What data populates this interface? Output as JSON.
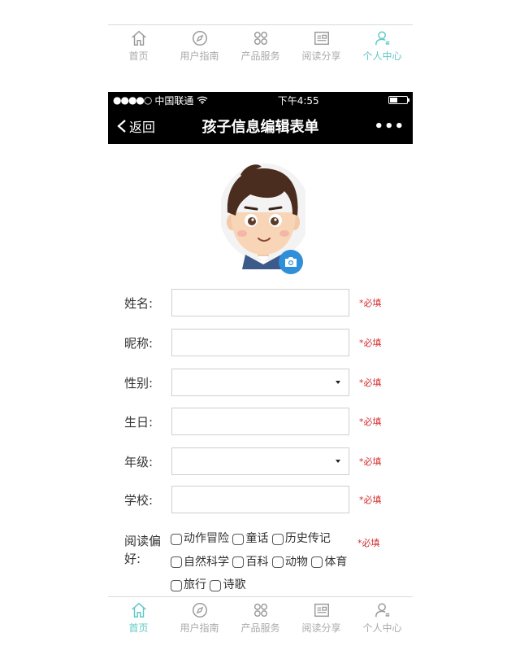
{
  "top_tabs": [
    {
      "label": "首页",
      "icon": "home-icon",
      "active": false
    },
    {
      "label": "用户指南",
      "icon": "compass-icon",
      "active": false
    },
    {
      "label": "产品服务",
      "icon": "grid-icon",
      "active": false
    },
    {
      "label": "阅读分享",
      "icon": "news-icon",
      "active": false
    },
    {
      "label": "个人中心",
      "icon": "user-icon",
      "active": true
    }
  ],
  "bottom_tabs": [
    {
      "label": "首页",
      "icon": "home-icon",
      "active": true
    },
    {
      "label": "用户指南",
      "icon": "compass-icon",
      "active": false
    },
    {
      "label": "产品服务",
      "icon": "grid-icon",
      "active": false
    },
    {
      "label": "阅读分享",
      "icon": "news-icon",
      "active": false
    },
    {
      "label": "个人中心",
      "icon": "user-icon",
      "active": false
    }
  ],
  "status_bar": {
    "carrier": "中国联通",
    "time": "下午4:55",
    "signal_dots": "●●●●○"
  },
  "nav": {
    "back_label": "返回",
    "title": "孩子信息编辑表单",
    "more": "•••"
  },
  "form": {
    "required_mark": "*必填",
    "fields": [
      {
        "label": "姓名:",
        "type": "text",
        "value": ""
      },
      {
        "label": "昵称:",
        "type": "text",
        "value": ""
      },
      {
        "label": "性别:",
        "type": "select",
        "value": ""
      },
      {
        "label": "生日:",
        "type": "text",
        "value": ""
      },
      {
        "label": "年级:",
        "type": "select",
        "value": ""
      },
      {
        "label": "学校:",
        "type": "text",
        "value": ""
      }
    ],
    "preferences": {
      "label_line1": "阅读偏",
      "label_line2": "好:",
      "options": [
        "动作冒险",
        "童话",
        "历史传记",
        "自然科学",
        "百科",
        "动物",
        "体育",
        "旅行",
        "诗歌"
      ]
    }
  },
  "colors": {
    "accent": "#5fc8c4",
    "required": "#d43030",
    "camera": "#2f8fd8",
    "bar": "#000000"
  }
}
